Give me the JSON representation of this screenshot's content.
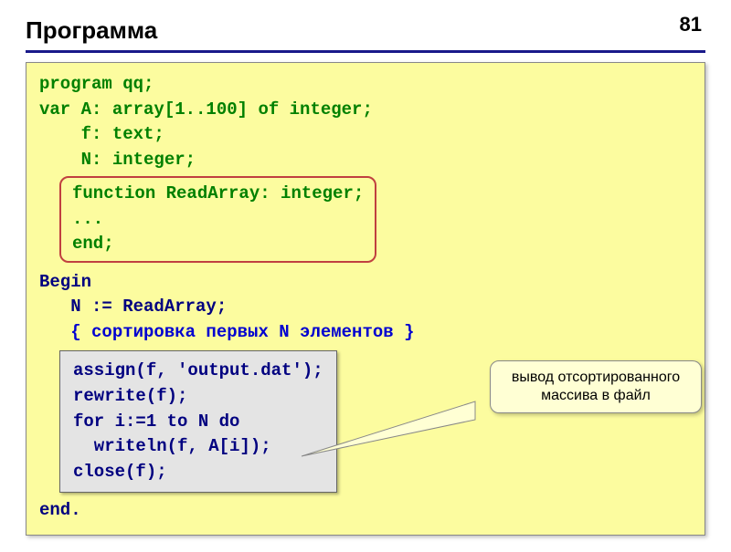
{
  "page_number": "81",
  "title": "Программа",
  "code": {
    "l1": "program qq;",
    "l2": "var A: array[1..100] of integer;",
    "l3": "    f: text;",
    "l4": "    N: integer;",
    "func": {
      "f1": "function ReadArray: integer;",
      "f2": "...",
      "f3": "end;"
    },
    "l5": "Begin",
    "l6": "   N := ReadArray;",
    "l7": "   { сортировка первых N элементов }",
    "grey": {
      "g1": "assign(f, 'output.dat');",
      "g2": "rewrite(f);",
      "g3": "for i:=1 to N do",
      "g4": "  writeln(f, A[i]);",
      "g5": "close(f);"
    },
    "l8": "end."
  },
  "callout": {
    "line1": "вывод отсортированного",
    "line2": "массива в файл"
  }
}
